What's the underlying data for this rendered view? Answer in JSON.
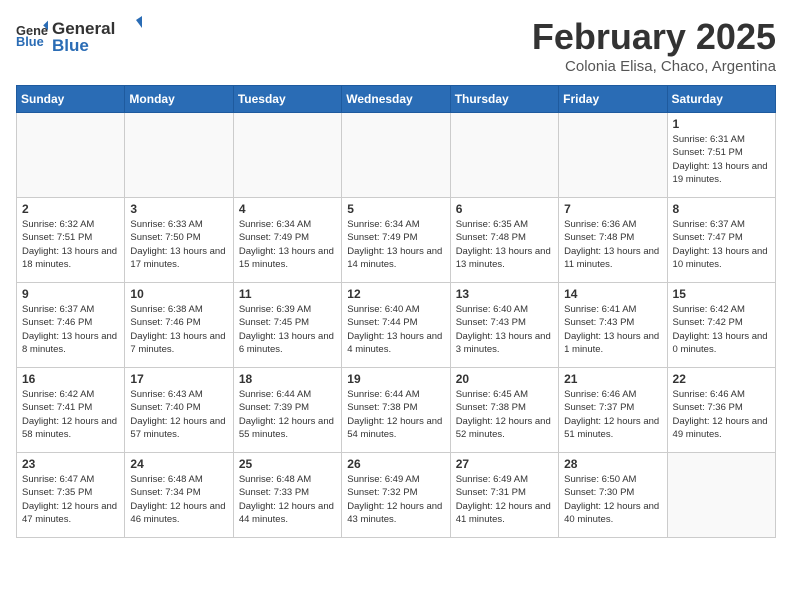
{
  "header": {
    "logo": {
      "general": "General",
      "blue": "Blue"
    },
    "title": "February 2025",
    "subtitle": "Colonia Elisa, Chaco, Argentina"
  },
  "calendar": {
    "weekdays": [
      "Sunday",
      "Monday",
      "Tuesday",
      "Wednesday",
      "Thursday",
      "Friday",
      "Saturday"
    ],
    "weeks": [
      [
        {
          "day": "",
          "info": ""
        },
        {
          "day": "",
          "info": ""
        },
        {
          "day": "",
          "info": ""
        },
        {
          "day": "",
          "info": ""
        },
        {
          "day": "",
          "info": ""
        },
        {
          "day": "",
          "info": ""
        },
        {
          "day": "1",
          "info": "Sunrise: 6:31 AM\nSunset: 7:51 PM\nDaylight: 13 hours and 19 minutes."
        }
      ],
      [
        {
          "day": "2",
          "info": "Sunrise: 6:32 AM\nSunset: 7:51 PM\nDaylight: 13 hours and 18 minutes."
        },
        {
          "day": "3",
          "info": "Sunrise: 6:33 AM\nSunset: 7:50 PM\nDaylight: 13 hours and 17 minutes."
        },
        {
          "day": "4",
          "info": "Sunrise: 6:34 AM\nSunset: 7:49 PM\nDaylight: 13 hours and 15 minutes."
        },
        {
          "day": "5",
          "info": "Sunrise: 6:34 AM\nSunset: 7:49 PM\nDaylight: 13 hours and 14 minutes."
        },
        {
          "day": "6",
          "info": "Sunrise: 6:35 AM\nSunset: 7:48 PM\nDaylight: 13 hours and 13 minutes."
        },
        {
          "day": "7",
          "info": "Sunrise: 6:36 AM\nSunset: 7:48 PM\nDaylight: 13 hours and 11 minutes."
        },
        {
          "day": "8",
          "info": "Sunrise: 6:37 AM\nSunset: 7:47 PM\nDaylight: 13 hours and 10 minutes."
        }
      ],
      [
        {
          "day": "9",
          "info": "Sunrise: 6:37 AM\nSunset: 7:46 PM\nDaylight: 13 hours and 8 minutes."
        },
        {
          "day": "10",
          "info": "Sunrise: 6:38 AM\nSunset: 7:46 PM\nDaylight: 13 hours and 7 minutes."
        },
        {
          "day": "11",
          "info": "Sunrise: 6:39 AM\nSunset: 7:45 PM\nDaylight: 13 hours and 6 minutes."
        },
        {
          "day": "12",
          "info": "Sunrise: 6:40 AM\nSunset: 7:44 PM\nDaylight: 13 hours and 4 minutes."
        },
        {
          "day": "13",
          "info": "Sunrise: 6:40 AM\nSunset: 7:43 PM\nDaylight: 13 hours and 3 minutes."
        },
        {
          "day": "14",
          "info": "Sunrise: 6:41 AM\nSunset: 7:43 PM\nDaylight: 13 hours and 1 minute."
        },
        {
          "day": "15",
          "info": "Sunrise: 6:42 AM\nSunset: 7:42 PM\nDaylight: 13 hours and 0 minutes."
        }
      ],
      [
        {
          "day": "16",
          "info": "Sunrise: 6:42 AM\nSunset: 7:41 PM\nDaylight: 12 hours and 58 minutes."
        },
        {
          "day": "17",
          "info": "Sunrise: 6:43 AM\nSunset: 7:40 PM\nDaylight: 12 hours and 57 minutes."
        },
        {
          "day": "18",
          "info": "Sunrise: 6:44 AM\nSunset: 7:39 PM\nDaylight: 12 hours and 55 minutes."
        },
        {
          "day": "19",
          "info": "Sunrise: 6:44 AM\nSunset: 7:38 PM\nDaylight: 12 hours and 54 minutes."
        },
        {
          "day": "20",
          "info": "Sunrise: 6:45 AM\nSunset: 7:38 PM\nDaylight: 12 hours and 52 minutes."
        },
        {
          "day": "21",
          "info": "Sunrise: 6:46 AM\nSunset: 7:37 PM\nDaylight: 12 hours and 51 minutes."
        },
        {
          "day": "22",
          "info": "Sunrise: 6:46 AM\nSunset: 7:36 PM\nDaylight: 12 hours and 49 minutes."
        }
      ],
      [
        {
          "day": "23",
          "info": "Sunrise: 6:47 AM\nSunset: 7:35 PM\nDaylight: 12 hours and 47 minutes."
        },
        {
          "day": "24",
          "info": "Sunrise: 6:48 AM\nSunset: 7:34 PM\nDaylight: 12 hours and 46 minutes."
        },
        {
          "day": "25",
          "info": "Sunrise: 6:48 AM\nSunset: 7:33 PM\nDaylight: 12 hours and 44 minutes."
        },
        {
          "day": "26",
          "info": "Sunrise: 6:49 AM\nSunset: 7:32 PM\nDaylight: 12 hours and 43 minutes."
        },
        {
          "day": "27",
          "info": "Sunrise: 6:49 AM\nSunset: 7:31 PM\nDaylight: 12 hours and 41 minutes."
        },
        {
          "day": "28",
          "info": "Sunrise: 6:50 AM\nSunset: 7:30 PM\nDaylight: 12 hours and 40 minutes."
        },
        {
          "day": "",
          "info": ""
        }
      ]
    ]
  }
}
